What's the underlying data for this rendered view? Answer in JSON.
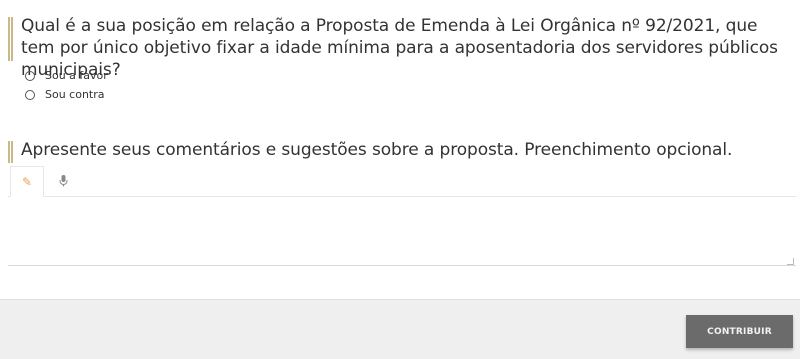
{
  "question1": {
    "text": "Qual é a sua posição em relação a Proposta de Emenda à Lei Orgânica nº 92/2021, que tem por único objetivo fixar a idade mínima para a aposentadoria dos servidores públicos municipais?",
    "options": [
      {
        "label": "Sou a favor"
      },
      {
        "label": "Sou contra"
      }
    ]
  },
  "question2": {
    "text": "Apresente seus comentários e sugestões sobre a proposta. Preenchimento opcional.",
    "tabs": [
      {
        "icon": "pencil-icon"
      },
      {
        "icon": "microphone-icon"
      }
    ],
    "textarea_value": ""
  },
  "footer": {
    "submit_label": "CONTRIBUIR"
  },
  "colors": {
    "accent_bar": "#c9b98a",
    "pencil": "#e8a253",
    "button_bg": "#6b6b6b"
  }
}
